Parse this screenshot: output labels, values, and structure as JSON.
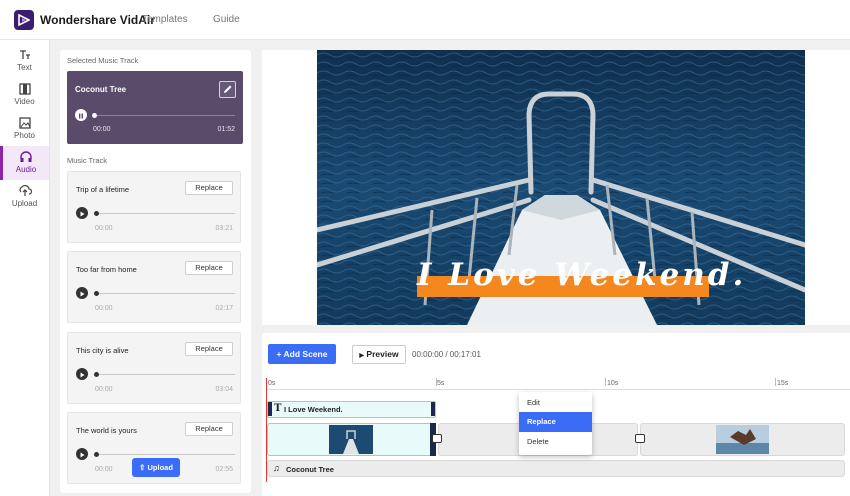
{
  "app": {
    "name": "Wondershare VidAir"
  },
  "nav": {
    "templates": "Templates",
    "guide": "Guide"
  },
  "sidebar": {
    "items": [
      {
        "label": "Text",
        "icon": "text-icon"
      },
      {
        "label": "Video",
        "icon": "video-icon"
      },
      {
        "label": "Photo",
        "icon": "photo-icon"
      },
      {
        "label": "Audio",
        "icon": "headphones-icon",
        "active": true
      },
      {
        "label": "Upload",
        "icon": "upload-icon"
      }
    ]
  },
  "music": {
    "selected_heading": "Selected Music Track",
    "selected": {
      "title": "Coconut Tree",
      "current": "00:00",
      "duration": "01:52"
    },
    "list_heading": "Music Track",
    "tracks": [
      {
        "title": "Trip of a lifetime",
        "current": "00:00",
        "duration": "03:21",
        "action": "Replace"
      },
      {
        "title": "Too far from home",
        "current": "00:00",
        "duration": "02:17",
        "action": "Replace"
      },
      {
        "title": "This city is alive",
        "current": "00:00",
        "duration": "03:04",
        "action": "Replace"
      },
      {
        "title": "The world is yours",
        "current": "00:00",
        "duration": "02:55",
        "action": "Replace"
      }
    ],
    "upload_label": "Upload"
  },
  "preview": {
    "caption": "I Love Weekend."
  },
  "timeline": {
    "add_scene": "Add Scene",
    "preview": "Preview",
    "time": "00:00:00 / 00:17:01",
    "ticks": [
      "0s",
      "5s",
      "10s",
      "15s"
    ],
    "text_clip": "I Love Weekend.",
    "audio_clip": "Coconut Tree"
  },
  "context_menu": {
    "items": [
      "Edit",
      "Replace",
      "Delete"
    ],
    "active": "Replace"
  },
  "colors": {
    "accent": "#3b6cf6",
    "brand": "#3a1d6e",
    "caption_bg": "#f5871f",
    "selected_card": "#5a4b6b"
  }
}
